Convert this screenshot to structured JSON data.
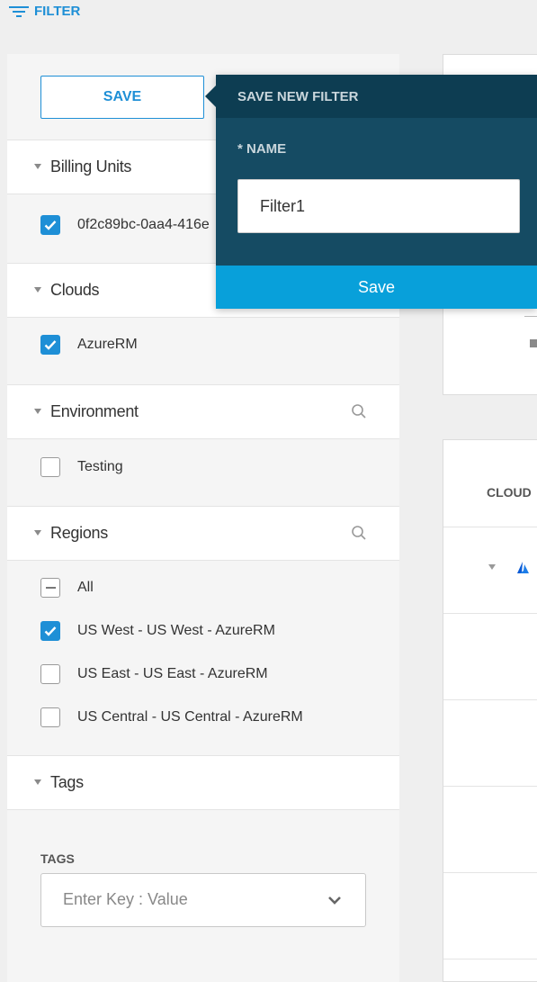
{
  "filter_toggle": {
    "label": "FILTER",
    "icon": "filter-lines-icon"
  },
  "left_panel": {
    "save_label": "SAVE",
    "sections": {
      "billing_units": {
        "title": "Billing Units",
        "items": [
          {
            "label": "0f2c89bc-0aa4-416e",
            "checked": true
          }
        ]
      },
      "clouds": {
        "title": "Clouds",
        "items": [
          {
            "label": "AzureRM",
            "checked": true
          }
        ]
      },
      "environment": {
        "title": "Environment",
        "items": [
          {
            "label": "Testing",
            "checked": false
          }
        ]
      },
      "regions": {
        "title": "Regions",
        "items": [
          {
            "label": "All",
            "state": "partial"
          },
          {
            "label": "US West - US West - AzureRM",
            "checked": true
          },
          {
            "label": "US East - US East - AzureRM",
            "checked": false
          },
          {
            "label": "US Central - US Central - AzureRM",
            "checked": false
          }
        ]
      },
      "tags": {
        "title": "Tags",
        "field_label": "TAGS",
        "placeholder": "Enter Key : Value"
      }
    }
  },
  "popover": {
    "title": "SAVE NEW FILTER",
    "name_label": "* NAME",
    "name_value": "Filter1",
    "save_label": "Save"
  },
  "right_panel": {
    "column_header": "CLOUD"
  },
  "colors": {
    "accent": "#1e8fd6",
    "popover_bg": "#154b63",
    "popover_header": "#0d3d52",
    "popover_button": "#08a0da"
  }
}
